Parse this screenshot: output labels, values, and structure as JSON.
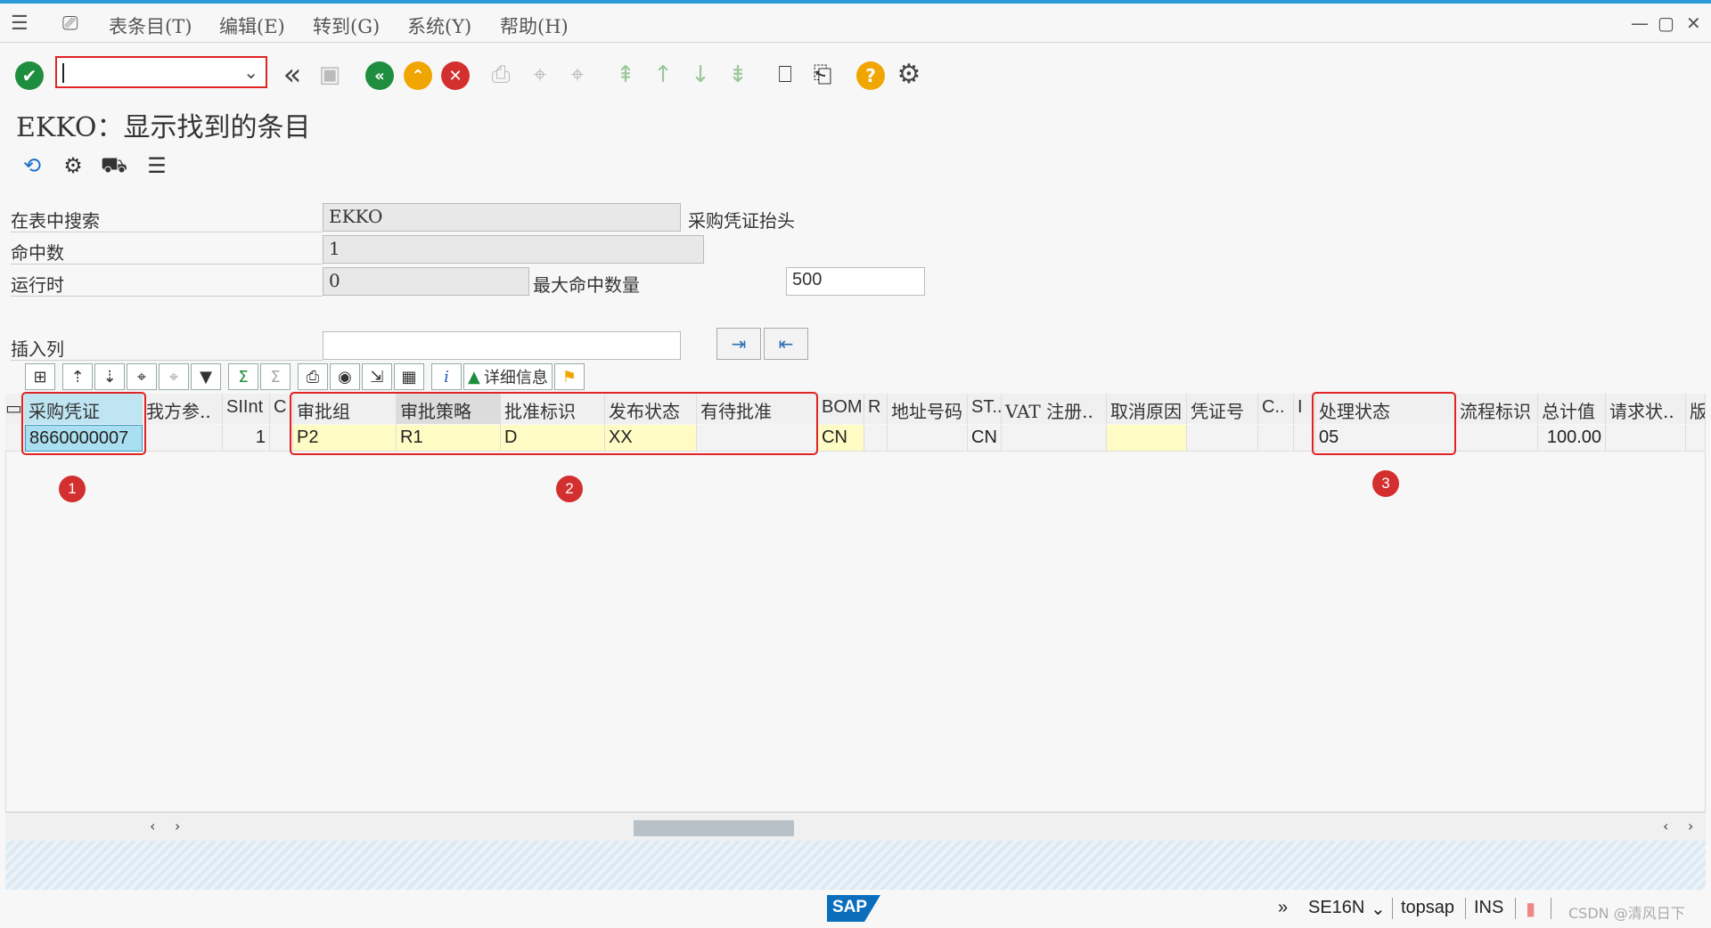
{
  "menu": {
    "items": [
      "表条目(T)",
      "编辑(E)",
      "转到(G)",
      "系统(Y)",
      "帮助(H)"
    ],
    "window_controls": [
      "—",
      "▢",
      "✕"
    ]
  },
  "toolbar": {
    "command_field_value": "",
    "icons": [
      "enter-icon",
      "back-icon",
      "save-icon",
      "back-green-icon",
      "exit-icon",
      "cancel-icon",
      "print-icon",
      "find-icon",
      "find-next-icon",
      "first-page-icon",
      "prev-page-icon",
      "next-page-icon",
      "last-page-icon",
      "new-session-icon",
      "shortcut-icon",
      "help-icon",
      "settings-icon"
    ]
  },
  "page": {
    "title": "EKKO：显示找到的条目"
  },
  "form": {
    "search_in_table_label": "在表中搜索",
    "search_in_table_value": "EKKO",
    "search_in_table_desc": "采购凭证抬头",
    "hits_label": "命中数",
    "hits_value": "1",
    "runtime_label": "运行时",
    "runtime_value": "0",
    "max_hits_label": "最大命中数量",
    "max_hits_value": "500",
    "insert_col_label": "插入列",
    "insert_col_value": ""
  },
  "alv": {
    "details_label": "详细信息",
    "sum_symbol": "Σ",
    "info_symbol": "i"
  },
  "table": {
    "headers": [
      "采购凭证",
      "我方参..",
      "SIInt",
      "C",
      "审批组",
      "审批策略",
      "批准标识",
      "发布状态",
      "有待批准",
      "BOM",
      "R",
      "地址号码",
      "ST..",
      "VAT 注册..",
      "取消原因",
      "凭证号",
      "C..",
      "I",
      "处理状态",
      "流程标识",
      "总计值",
      "请求状..",
      "版"
    ],
    "row": [
      "8660000007",
      "",
      "1",
      "",
      "P2",
      "R1",
      "D",
      "XX",
      "",
      "CN",
      "",
      "",
      "CN",
      "",
      "",
      "",
      "",
      "",
      "05",
      "",
      "100.00",
      "",
      ""
    ]
  },
  "annotations": [
    "1",
    "2",
    "3"
  ],
  "statusbar": {
    "logo": "SAP",
    "transaction": "SE16N",
    "system": "topsap",
    "mode": "INS",
    "watermark": "CSDN @清风日下"
  },
  "colors": {
    "accent_line": "#2a9bd8",
    "highlight_red": "#e02424",
    "selected_cell": "#a9dff0",
    "editable_cell": "#fffbc4"
  }
}
